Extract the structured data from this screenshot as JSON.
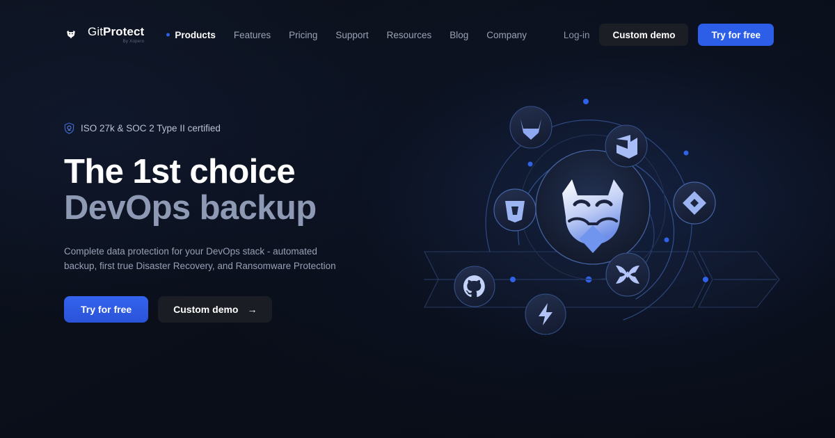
{
  "brand": {
    "name_light": "Git",
    "name_bold": "Protect",
    "tagline": "By Xopero",
    "logo_icon": "tiger-shield-icon"
  },
  "nav": {
    "items": [
      {
        "label": "Products",
        "active": true
      },
      {
        "label": "Features",
        "active": false
      },
      {
        "label": "Pricing",
        "active": false
      },
      {
        "label": "Support",
        "active": false
      },
      {
        "label": "Resources",
        "active": false
      },
      {
        "label": "Blog",
        "active": false
      },
      {
        "label": "Company",
        "active": false
      }
    ]
  },
  "header_actions": {
    "login_label": "Log-in",
    "custom_demo_label": "Custom demo",
    "try_free_label": "Try for free"
  },
  "hero": {
    "badge_text": "ISO 27k & SOC 2 Type II certified",
    "badge_icon": "shield-check-icon",
    "headline_line1": "The 1st choice",
    "headline_line2": "DevOps backup",
    "subtitle": "Complete data protection for your DevOps stack - automated backup, first true Disaster Recovery, and Ransomware Protection",
    "cta_primary_label": "Try for free",
    "cta_secondary_label": "Custom demo",
    "cta_secondary_arrow": "→"
  },
  "graphic": {
    "center_icon": "gitprotect-tiger-icon",
    "orbit_icons": [
      "gitlab-icon",
      "azure-devops-icon",
      "bitbucket-icon",
      "jira-icon",
      "confluence-icon",
      "github-icon",
      "lightning-bolt-icon"
    ]
  },
  "colors": {
    "accent_blue": "#2d5ee8",
    "background": "#0b101c",
    "headline_primary": "#ffffff",
    "headline_secondary": "#8e99b4",
    "muted_text": "#97a1b5",
    "icon_blue": "#8fa8f0"
  }
}
